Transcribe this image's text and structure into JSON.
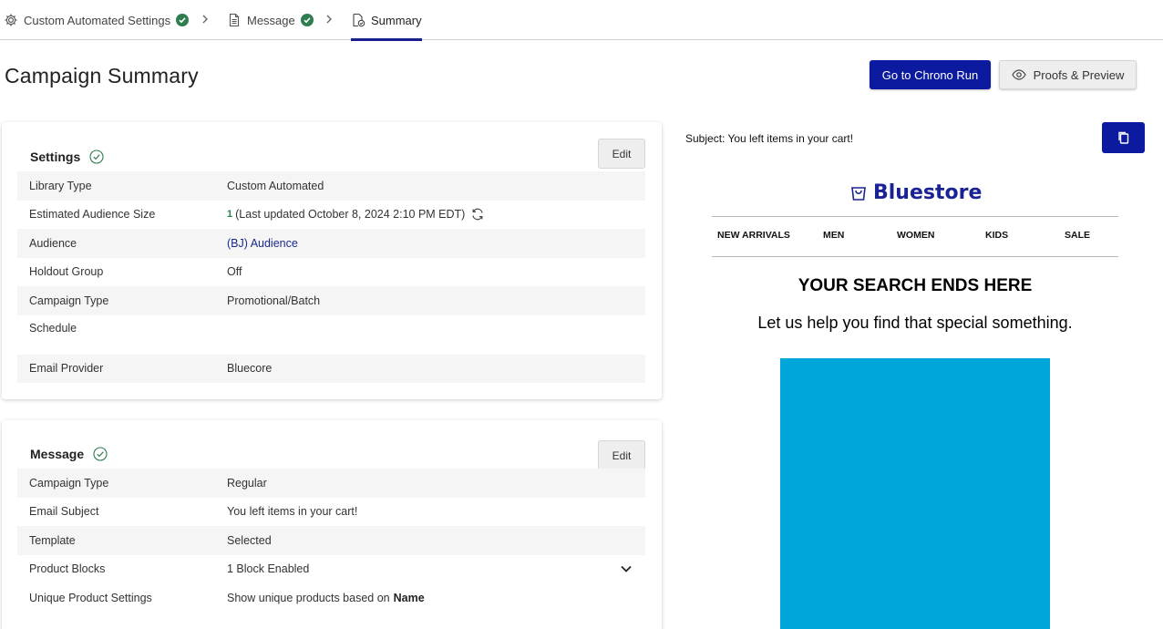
{
  "stepper": {
    "steps": [
      {
        "label": "Custom Automated Settings",
        "complete": true
      },
      {
        "label": "Message",
        "complete": true
      },
      {
        "label": "Summary",
        "complete": false,
        "active": true
      }
    ]
  },
  "header": {
    "title": "Campaign Summary",
    "primary_button": "Go to Chrono Run",
    "secondary_button": "Proofs & Preview"
  },
  "settings": {
    "title": "Settings",
    "edit_label": "Edit",
    "rows": [
      {
        "key": "Library Type",
        "value": "Custom Automated"
      },
      {
        "key": "Estimated Audience Size",
        "count": "1",
        "value": "(Last updated October 8, 2024 2:10 PM EDT)"
      },
      {
        "key": "Audience",
        "value": "(BJ) Audience"
      },
      {
        "key": "Holdout Group",
        "value": "Off"
      },
      {
        "key": "Campaign Type",
        "value": "Promotional/Batch"
      },
      {
        "key": "Schedule",
        "value": ""
      },
      {
        "key": "Email Provider",
        "value": "Bluecore"
      }
    ]
  },
  "message": {
    "title": "Message",
    "edit_label": "Edit",
    "rows": [
      {
        "key": "Campaign Type",
        "value": "Regular"
      },
      {
        "key": "Email Subject",
        "value": "You left items in your cart!"
      },
      {
        "key": "Template",
        "value": "Selected"
      },
      {
        "key": "Product Blocks",
        "value": "1 Block Enabled"
      },
      {
        "key": "Unique Product Settings",
        "value": "Show unique products based on",
        "emphasis": "Name"
      }
    ]
  },
  "preview": {
    "subject": "Subject: You left items in your cart!",
    "brand": "Bluestore",
    "nav": [
      "NEW ARRIVALS",
      "MEN",
      "WOMEN",
      "KIDS",
      "SALE"
    ],
    "headline": "YOUR SEARCH ENDS HERE",
    "subline": "Let us help you find that special something.",
    "hero_color": "#00a6d9"
  },
  "colors": {
    "primary": "#0c1aa0",
    "success": "#2e7d4f",
    "link": "#1a2a8f"
  }
}
